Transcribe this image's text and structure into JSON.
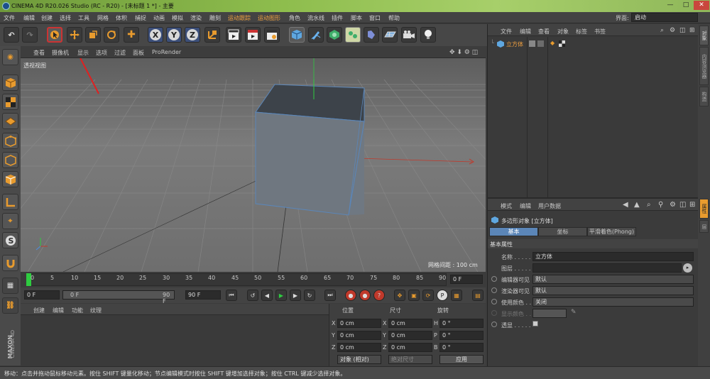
{
  "window": {
    "title": "CINEMA 4D R20.026 Studio (RC - R20) - [未标题 1 *] - 主要",
    "min": "—",
    "max": "□",
    "close": "✕"
  },
  "menu": {
    "items": [
      "文件",
      "编辑",
      "创建",
      "选择",
      "工具",
      "网格",
      "体积",
      "捕捉",
      "动画",
      "模拟",
      "渲染",
      "雕刻",
      "运动跟踪",
      "运动图形",
      "角色",
      "流水线",
      "插件",
      "脚本",
      "窗口",
      "帮助"
    ],
    "layout_label": "界面:",
    "layout_value": "启动"
  },
  "toolbar": {
    "undo": "↶",
    "redo": "↷",
    "x_axis": "X",
    "y_axis": "Y",
    "z_axis": "Z"
  },
  "viewport": {
    "menu": [
      "查看",
      "摄像机",
      "显示",
      "选项",
      "过滤",
      "面板",
      "ProRender"
    ],
    "label": "透视视图",
    "grid_spacing": "网格间距 : 100 cm",
    "nav_icons": "✥ ⬇ ⚙ ◫"
  },
  "timeline": {
    "ticks": [
      "0",
      "5",
      "10",
      "15",
      "20",
      "25",
      "30",
      "35",
      "40",
      "45",
      "50",
      "55",
      "60",
      "65",
      "70",
      "75",
      "80",
      "85",
      "90"
    ],
    "end_frame": "0 F"
  },
  "transport": {
    "current_frame": "0 F",
    "range_start": "0 F",
    "range_end": "90 F",
    "max_frame": "90 F"
  },
  "material_panel": {
    "menu": [
      "创建",
      "编辑",
      "功能",
      "纹理"
    ]
  },
  "coords": {
    "headers": [
      "位置",
      "尺寸",
      "旋转"
    ],
    "rows": [
      {
        "a": "X",
        "pos": "0 cm",
        "b": "X",
        "size": "0 cm",
        "c": "H",
        "rot": "0 °"
      },
      {
        "a": "Y",
        "pos": "0 cm",
        "b": "Y",
        "size": "0 cm",
        "c": "P",
        "rot": "0 °"
      },
      {
        "a": "Z",
        "pos": "0 cm",
        "b": "Z",
        "size": "0 cm",
        "c": "B",
        "rot": "0 °"
      }
    ],
    "mode": "对象 (相对)",
    "size_mode": "绝对尺寸",
    "apply": "应用"
  },
  "object_manager": {
    "menu": [
      "文件",
      "编辑",
      "查看",
      "对象",
      "标签",
      "书签"
    ],
    "objects": [
      {
        "name": "立方体"
      }
    ]
  },
  "attr_manager": {
    "menu": [
      "模式",
      "编辑",
      "用户数据"
    ],
    "object_title": "多边形对象 [立方体]",
    "tabs": [
      "基本",
      "坐标",
      "平滑着色(Phong)"
    ],
    "section": "基本属性",
    "fields": [
      {
        "label": "名称 . . . . .",
        "value": "立方体"
      },
      {
        "label": "图层 . . . . .",
        "value": ""
      },
      {
        "label": "编辑器可见",
        "value": "默认"
      },
      {
        "label": "渲染器可见",
        "value": "默认"
      },
      {
        "label": "使用颜色 . . .",
        "value": "关闭"
      },
      {
        "label": "显示颜色 . .",
        "value": ""
      },
      {
        "label": "透显 . . . . .",
        "value": ""
      }
    ]
  },
  "right_tabs": [
    "对象",
    "内容浏览器",
    "构造",
    "属性",
    "层"
  ],
  "brand": {
    "line1": "MAXON",
    "line2": "CINEMA 4D"
  },
  "status": {
    "text": "移动：点击并拖动鼠标移动元素。按住 SHIFT 键量化移动；节点编辑模式时按住 SHIFT 键增加选择对象；按住 CTRL 键减少选择对象。"
  },
  "colors": {
    "accent": "#e89b2e",
    "selection": "#5b86b8",
    "x_axis": "#c0392b",
    "y_axis": "#2ecc40"
  }
}
